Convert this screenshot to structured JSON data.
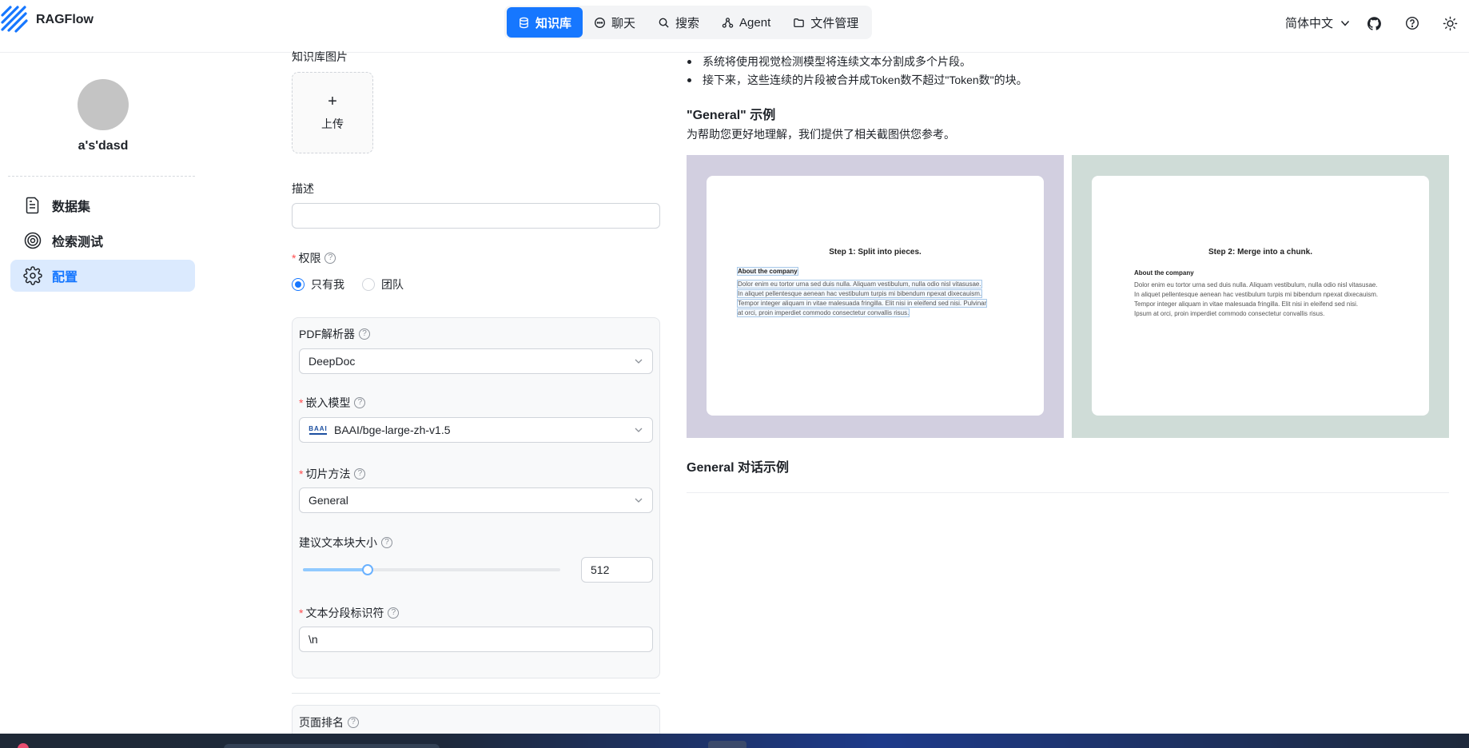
{
  "header": {
    "app_title": "RAGFlow",
    "nav": [
      {
        "label": "知识库",
        "icon": "database-icon",
        "active": true
      },
      {
        "label": "聊天",
        "icon": "chat-icon",
        "active": false
      },
      {
        "label": "搜索",
        "icon": "search-icon",
        "active": false
      },
      {
        "label": "Agent",
        "icon": "agent-icon",
        "active": false
      },
      {
        "label": "文件管理",
        "icon": "folder-icon",
        "active": false
      }
    ],
    "language": "简体中文"
  },
  "sidebar": {
    "kb_name": "a's'dasd",
    "items": [
      {
        "label": "数据集",
        "icon": "dataset-icon",
        "active": false
      },
      {
        "label": "检索测试",
        "icon": "target-icon",
        "active": false
      },
      {
        "label": "配置",
        "icon": "gear-icon",
        "active": true
      }
    ]
  },
  "form": {
    "kb_image_label": "知识库图片",
    "upload_label": "上传",
    "description_label": "描述",
    "description_value": "",
    "permission_label": "权限",
    "permission_options": [
      "只有我",
      "团队"
    ],
    "permission_selected": "只有我",
    "pdf_parser_label": "PDF解析器",
    "pdf_parser_value": "DeepDoc",
    "embedding_label": "嵌入模型",
    "embedding_value": "BAAI/bge-large-zh-v1.5",
    "embedding_logo_text": "BAAI",
    "chunk_method_label": "切片方法",
    "chunk_method_value": "General",
    "chunk_size_label": "建议文本块大小",
    "chunk_size_value": "512",
    "chunk_size_fraction": 0.25,
    "delimiter_label": "文本分段标识符",
    "delimiter_value": "\\n",
    "page_rank_label": "页面排名"
  },
  "help": {
    "bullets": [
      "系统将使用视觉检测模型将连续文本分割成多个片段。",
      "接下来，这些连续的片段被合并成Token数不超过\"Token数\"的块。"
    ],
    "example_title": "\"General\" 示例",
    "example_desc": "为帮助您更好地理解，我们提供了相关截图供您参考。",
    "images": [
      {
        "bg": "#d2cfe0",
        "step_title": "Step 1: Split into pieces.",
        "heading": "About the company",
        "lines": [
          "Dolor enim eu tortor urna sed duis nulla. Aliquam vestibulum, nulla odio nisl vitasusae.",
          "In aliquet pellentesque aenean hac vestibulum turpis mi bibendum npexat dixecauism.",
          "Tempor integer aliquam in vitae malesuada fringilla. Elit nisi in eleifend sed nisi. Pulvinar",
          "at orci, proin imperdiet commodo consectetur convallis risus."
        ]
      },
      {
        "bg": "#cfdcd7",
        "step_title": "Step 2: Merge into a chunk.",
        "heading": "About the company",
        "lines": [
          "Dolor enim eu tortor urna sed duis nulla. Aliquam vestibulum, nulla odio nisl vitasusae.",
          "In aliquet pellentesque aenean hac vestibulum turpis mi bibendum npexat dixecauism.",
          "Tempor integer aliquam in vitae malesuada fringilla. Elit nisi in eleifend sed nisi.",
          "Ipsum at orci, proin imperdiet commodo consectetur convallis risus."
        ]
      }
    ],
    "conversation_title": "General 对话示例"
  },
  "colors": {
    "accent": "#1677ff",
    "required": "#ff4d4f",
    "active_bg": "#dbeafe"
  }
}
